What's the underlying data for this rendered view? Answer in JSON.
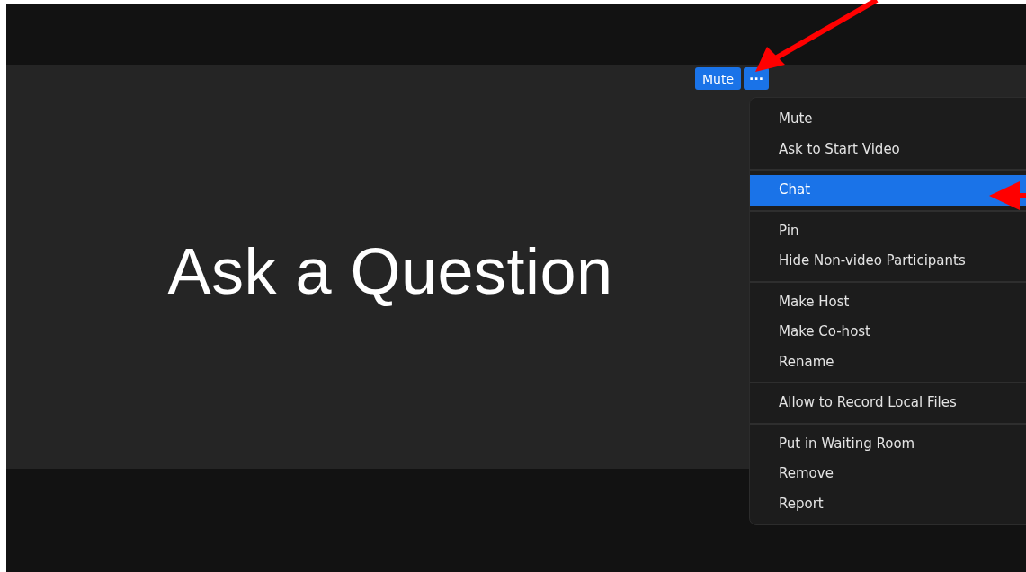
{
  "tile": {
    "title": "Ask a Question"
  },
  "controls": {
    "mute_button": "Mute",
    "more_button": "···"
  },
  "menu": {
    "groups": [
      [
        {
          "label": "Mute",
          "selected": false
        },
        {
          "label": "Ask to Start Video",
          "selected": false
        }
      ],
      [
        {
          "label": "Chat",
          "selected": true
        }
      ],
      [
        {
          "label": "Pin",
          "selected": false
        },
        {
          "label": "Hide Non-video Participants",
          "selected": false
        }
      ],
      [
        {
          "label": "Make Host",
          "selected": false
        },
        {
          "label": "Make Co-host",
          "selected": false
        },
        {
          "label": "Rename",
          "selected": false
        }
      ],
      [
        {
          "label": "Allow to Record Local Files",
          "selected": false
        }
      ],
      [
        {
          "label": "Put in Waiting Room",
          "selected": false
        },
        {
          "label": "Remove",
          "selected": false
        },
        {
          "label": "Report",
          "selected": false
        }
      ]
    ]
  }
}
